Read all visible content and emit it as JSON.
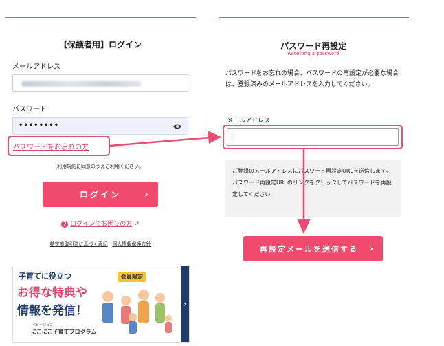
{
  "login": {
    "title": "【保護者用】ログイン",
    "email_label": "メールアドレス",
    "password_label": "パスワード",
    "password_mask": "••••••••",
    "forgot_link": "パスワードをお忘れの方",
    "terms_link": "利用規約",
    "terms_text": "に同意のうえご利用ください。",
    "login_button": "ログイン",
    "help_link": "ログインでお困りの方",
    "footer_link_1": "特定商取引法に基づく表記",
    "footer_link_2": "個人情報保護方針"
  },
  "banner": {
    "line1": "子育てに役立つ",
    "line2": "お得な特典や",
    "line3": "情報を発信！",
    "badge": "会員限定",
    "brand_small": "ベビージョブ",
    "brand": "にこにこ子育てプログラム"
  },
  "reset": {
    "title": "パスワード再設定",
    "subtitle": "Resetting a password",
    "description": "パスワードをお忘れの場合、パスワードの再設定が必要な場合は、登録済みのメールアドレスを入力してください。",
    "email_label": "メールアドレス",
    "notice_line1": "ご登録のメールアドレスにパスワード再設定URLを送信します。",
    "notice_line2": "パスワード再設定URLのリンクをクリックしてパスワードを再設定してください",
    "send_button": "再設定メールを送信する"
  },
  "colors": {
    "accent": "#f04a6c",
    "callout": "#ea4c73"
  }
}
